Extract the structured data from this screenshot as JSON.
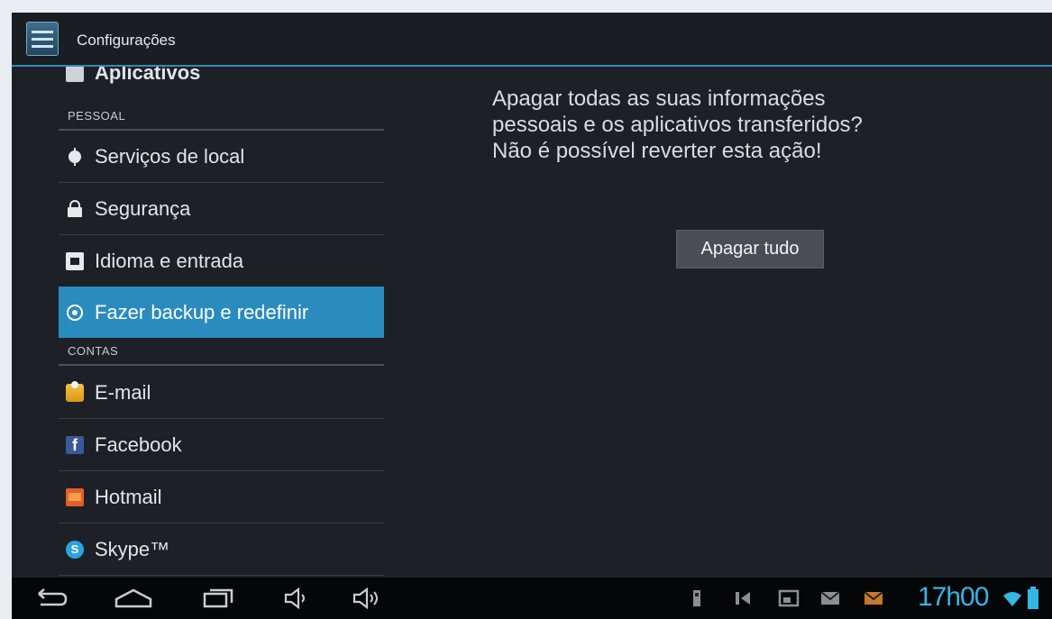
{
  "app": {
    "title": "Configurações",
    "icon": "settings-sliders-icon"
  },
  "sidebar": {
    "partial_item": {
      "label": "Aplicativos",
      "icon": "apps-grid-icon"
    },
    "sections": [
      {
        "header": "PESSOAL",
        "items": [
          {
            "label": "Serviços de local",
            "icon": "location-icon",
            "selected": false
          },
          {
            "label": "Segurança",
            "icon": "lock-icon",
            "selected": false
          },
          {
            "label": "Idioma e entrada",
            "icon": "keyboard-icon",
            "selected": false
          },
          {
            "label": "Fazer backup e redefinir",
            "icon": "backup-icon",
            "selected": true
          }
        ]
      },
      {
        "header": "CONTAS",
        "items": [
          {
            "label": "E-mail",
            "icon": "email-icon",
            "selected": false
          },
          {
            "label": "Facebook",
            "icon": "facebook-icon",
            "selected": false
          },
          {
            "label": "Hotmail",
            "icon": "hotmail-icon",
            "selected": false
          },
          {
            "label": "Skype™",
            "icon": "skype-icon",
            "selected": false
          }
        ]
      }
    ]
  },
  "detail": {
    "message_lines": [
      "Apagar todas as suas informações",
      "pessoais e os aplicativos transferidos?",
      "Não é possível reverter esta ação!"
    ],
    "button_label": "Apagar tudo"
  },
  "system_bar": {
    "nav_icons": [
      "back-icon",
      "home-icon",
      "recent-apps-icon",
      "volume-down-icon",
      "volume-up-icon"
    ],
    "status_icons": [
      "usb-icon",
      "usb-debug-icon",
      "screenshot-icon",
      "mail-notification-icon",
      "email-notification-icon"
    ],
    "time": "17h00",
    "wifi_icon": "wifi-icon",
    "battery_icon": "battery-icon"
  },
  "colors": {
    "accent": "#2a8bbf",
    "clock": "#33b5e5",
    "background": "#1d2127"
  }
}
